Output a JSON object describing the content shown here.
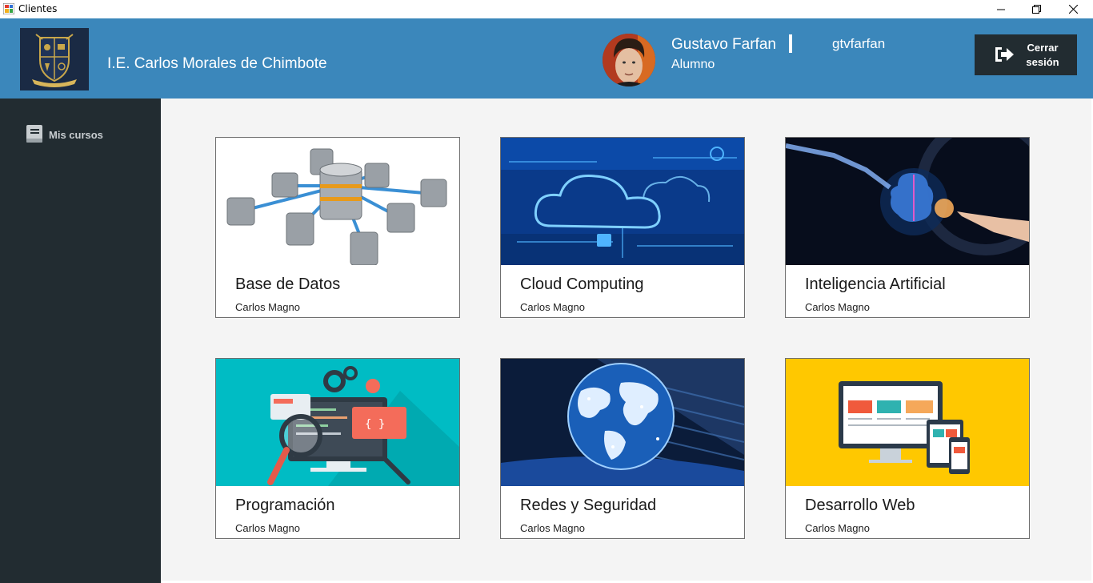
{
  "window": {
    "title": "Clientes"
  },
  "header": {
    "school_name": "I.E. Carlos Morales de Chimbote",
    "user": {
      "name": "Gustavo Farfan",
      "role": "Alumno",
      "username": "gtvfarfan"
    },
    "logout_label": "Cerrar\nsesión"
  },
  "sidebar": {
    "items": [
      {
        "label": "Mis cursos",
        "icon": "book-icon"
      }
    ]
  },
  "courses": [
    {
      "title": "Base de Datos",
      "teacher": "Carlos Magno"
    },
    {
      "title": "Cloud Computing",
      "teacher": "Carlos Magno"
    },
    {
      "title": "Inteligencia Artificial",
      "teacher": "Carlos Magno"
    },
    {
      "title": "Programación",
      "teacher": "Carlos Magno"
    },
    {
      "title": "Redes y Seguridad",
      "teacher": "Carlos Magno"
    },
    {
      "title": "Desarrollo Web",
      "teacher": "Carlos Magno"
    }
  ],
  "colors": {
    "header": "#3b87bb",
    "sidebar": "#222c31",
    "logout_button": "#222c31",
    "content_bg": "#f4f4f4"
  }
}
